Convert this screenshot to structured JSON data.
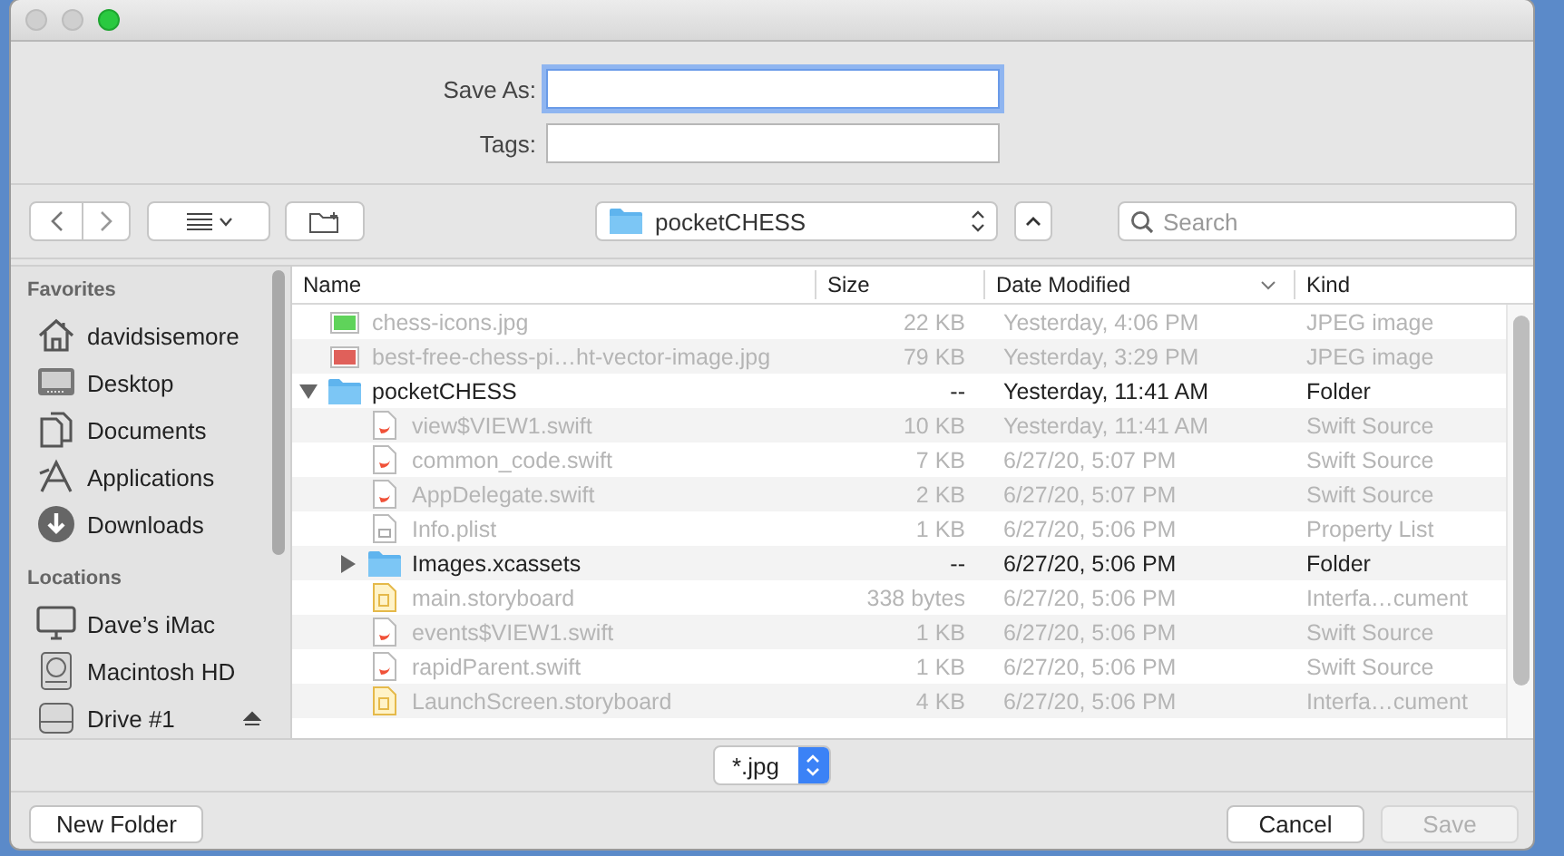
{
  "form": {
    "fields": [
      {
        "label": "Save As:",
        "focused": true
      },
      {
        "label": "Tags:",
        "focused": false
      }
    ]
  },
  "toolbar": {
    "location": "pocketCHESS",
    "search": {
      "placeholder": "Search"
    }
  },
  "sidebar": {
    "sections": [
      {
        "heading": "Favorites",
        "items": [
          {
            "label": "davidsisemore",
            "kind": "home",
            "ejectable": false,
            "selected": false
          },
          {
            "label": "Desktop",
            "kind": "desktop",
            "ejectable": false,
            "selected": false
          },
          {
            "label": "Documents",
            "kind": "documents",
            "ejectable": false,
            "selected": false
          },
          {
            "label": "Applications",
            "kind": "applications",
            "ejectable": false,
            "selected": false
          },
          {
            "label": "Downloads",
            "kind": "downloads",
            "ejectable": false,
            "selected": false
          }
        ]
      },
      {
        "heading": "Locations",
        "items": [
          {
            "label": "Dave’s iMac",
            "kind": "computer",
            "ejectable": false,
            "selected": false
          },
          {
            "label": "Macintosh HD",
            "kind": "disk",
            "ejectable": false,
            "selected": false
          },
          {
            "label": "Drive #1",
            "kind": "drive",
            "ejectable": true,
            "selected": false
          }
        ]
      }
    ]
  },
  "file_list": {
    "columns": [
      {
        "label": "Name",
        "sorted": false
      },
      {
        "label": "Size",
        "sorted": false
      },
      {
        "label": "Date Modified",
        "sorted": true
      },
      {
        "label": "Kind",
        "sorted": false
      }
    ],
    "rows": [
      {
        "name": "chess-icons.jpg",
        "size": "22 KB",
        "date": "Yesterday, 4:06 PM",
        "type": "JPEG image",
        "kind": "image",
        "color": "#5fd35a",
        "enabled": false
      },
      {
        "name": "best-free-chess-pi…ht-vector-image.jpg",
        "size": "79 KB",
        "date": "Yesterday, 3:29 PM",
        "type": "JPEG image",
        "kind": "image",
        "color": "#e0605a",
        "enabled": false
      },
      {
        "name": "pocketCHESS",
        "size": "--",
        "date": "Yesterday, 11:41 AM",
        "type": "Folder",
        "kind": "folder",
        "enabled": true,
        "expanded": true,
        "children": [
          {
            "name": "view$VIEW1.swift",
            "size": "10 KB",
            "date": "Yesterday, 11:41 AM",
            "type": "Swift Source",
            "kind": "swift",
            "enabled": false
          },
          {
            "name": "common_code.swift",
            "size": "7 KB",
            "date": "6/27/20, 5:07 PM",
            "type": "Swift Source",
            "kind": "swift",
            "enabled": false
          },
          {
            "name": "AppDelegate.swift",
            "size": "2 KB",
            "date": "6/27/20, 5:07 PM",
            "type": "Swift Source",
            "kind": "swift",
            "enabled": false
          },
          {
            "name": "Info.plist",
            "size": "1 KB",
            "date": "6/27/20, 5:06 PM",
            "type": "Property List",
            "kind": "plist",
            "enabled": false
          },
          {
            "name": "Images.xcassets",
            "size": "--",
            "date": "6/27/20, 5:06 PM",
            "type": "Folder",
            "kind": "folder",
            "enabled": true,
            "expanded": false
          },
          {
            "name": "main.storyboard",
            "size": "338 bytes",
            "date": "6/27/20, 5:06 PM",
            "type": "Interfa…cument",
            "kind": "storyboard",
            "enabled": false
          },
          {
            "name": "events$VIEW1.swift",
            "size": "1 KB",
            "date": "6/27/20, 5:06 PM",
            "type": "Swift Source",
            "kind": "swift",
            "enabled": false
          },
          {
            "name": "rapidParent.swift",
            "size": "1 KB",
            "date": "6/27/20, 5:06 PM",
            "type": "Swift Source",
            "kind": "swift",
            "enabled": false
          },
          {
            "name": "LaunchScreen.storyboard",
            "size": "4 KB",
            "date": "6/27/20, 5:06 PM",
            "type": "Interfa…cument",
            "kind": "storyboard",
            "enabled": false
          }
        ]
      }
    ]
  },
  "footer": {
    "file_type": "*.jpg",
    "buttons": [
      {
        "label": "New Folder",
        "disabled": false,
        "kind": "left"
      },
      {
        "label": "Cancel",
        "disabled": false,
        "kind": "right"
      },
      {
        "label": "Save",
        "disabled": true,
        "kind": "right"
      }
    ]
  }
}
